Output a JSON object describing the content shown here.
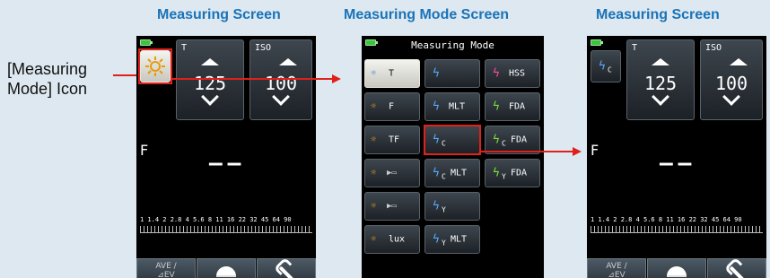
{
  "headings": {
    "left": "Measuring Screen",
    "middle": "Measuring Mode Screen",
    "right": "Measuring Screen"
  },
  "annotation": {
    "line1": "[Measuring",
    "line2": "Mode] Icon"
  },
  "screen_left": {
    "mode_icon": "sun-icon",
    "shutter": {
      "label": "T",
      "value": "125"
    },
    "iso": {
      "label": "ISO",
      "value": "100"
    },
    "f_label": "F",
    "reading": "––",
    "scale_text": "1 1.4 2 2.8 4 5.6 8 11 16 22 32 45 64 90",
    "buttons": {
      "ave_line1": "AVE /",
      "ave_line2": "⊿EV"
    }
  },
  "mode_screen": {
    "title": "Measuring Mode",
    "rows": [
      [
        "T",
        "",
        "HSS"
      ],
      [
        "F",
        "MLT",
        "FDA"
      ],
      [
        "TF",
        "",
        "FDA"
      ],
      [
        "",
        "MLT",
        "FDA"
      ],
      [
        "",
        "",
        ""
      ],
      [
        "lux",
        "MLT",
        ""
      ]
    ],
    "subs": [
      "C",
      "C",
      "C",
      "Y",
      "Y",
      "Y"
    ]
  },
  "screen_right": {
    "mode_icon": "flash-c-icon",
    "shutter": {
      "label": "T",
      "value": "125"
    },
    "iso": {
      "label": "ISO",
      "value": "100"
    },
    "f_label": "F",
    "reading": "––",
    "scale_text": "1 1.4 2 2.8 4 5.6 8 11 16 22 32 45 64 90",
    "buttons": {
      "ave_line1": "AVE /",
      "ave_line2": "⊿EV"
    }
  },
  "colors": {
    "heading": "#1a73b8",
    "highlight": "#e0201a",
    "battery": "#3cc43c"
  }
}
